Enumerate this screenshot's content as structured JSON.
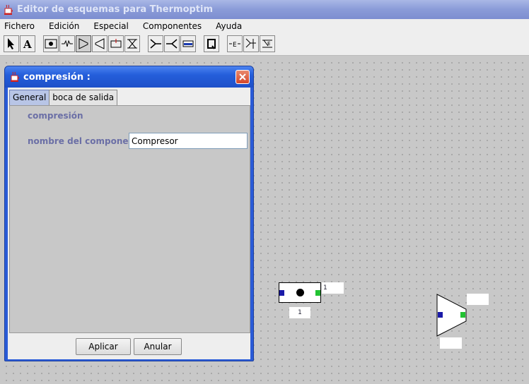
{
  "window": {
    "title": "Editor de esquemas para Thermoptim"
  },
  "menu": {
    "items": [
      "Fichero",
      "Edición",
      "Especial",
      "Componentes",
      "Ayuda"
    ]
  },
  "toolbar": {
    "tools": [
      {
        "name": "select-arrow-icon"
      },
      {
        "name": "text-tool-icon"
      },
      {
        "name": "node-tool-icon"
      },
      {
        "name": "process-tool-icon"
      },
      {
        "name": "compressor-tool-icon"
      },
      {
        "name": "turbine-tool-icon"
      },
      {
        "name": "combustion-tool-icon"
      },
      {
        "name": "expansion-valve-tool-icon"
      },
      {
        "name": "mixer-tool-icon"
      },
      {
        "name": "divider-tool-icon"
      },
      {
        "name": "heat-exchanger-tool-icon"
      },
      {
        "name": "q-tool-icon"
      },
      {
        "name": "exchange-tool-icon"
      },
      {
        "name": "connector-tool-icon"
      },
      {
        "name": "split-tool-icon"
      }
    ]
  },
  "dialog": {
    "title": "compresión :",
    "tabs": [
      "General",
      "boca de salida"
    ],
    "active_tab": 0,
    "section_header": "compresión",
    "name_label": "nombre del componente",
    "name_value": "Compresor",
    "apply_label": "Aplicar",
    "cancel_label": "Anular"
  },
  "diagram": {
    "node": {
      "inline_label": "1",
      "bottom_label": "1"
    },
    "compressor": {
      "top_label": "",
      "bottom_label": ""
    }
  },
  "colors": {
    "inlet_port": "#1a1aa8",
    "outlet_port": "#22c232"
  }
}
